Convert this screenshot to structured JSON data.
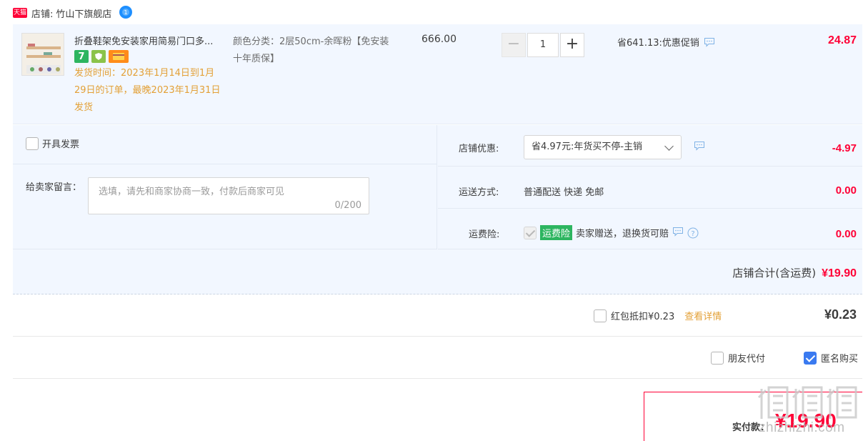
{
  "shop": {
    "platform_badge": "天猫",
    "label": "店铺:",
    "name": "竹山下旗舰店"
  },
  "item": {
    "title": "折叠鞋架免安装家用简易门口多...",
    "ship_time": "发货时间：2023年1月14日到1月29日的订单，最晚2023年1月31日发货",
    "spec": "颜色分类：2层50cm-余晖粉【免安装 十年质保】",
    "unit_price": "666.00",
    "quantity": "1",
    "qty_minus": "−",
    "qty_plus": "+",
    "promo": "省641.13:优惠促销",
    "total": "24.87",
    "tag_seven": "7"
  },
  "options": {
    "invoice_label": "开具发票",
    "message_label": "给卖家留言：",
    "message_placeholder": "选填，请先和商家协商一致，付款后商家可见",
    "message_count": "0/200",
    "shop_discount_label": "店铺优惠:",
    "shop_discount_selected": "省4.97元:年货买不停-主销",
    "shop_discount_value": "-4.97",
    "shipping_label": "运送方式:",
    "shipping_method": "普通配送 快递 免邮",
    "shipping_value": "0.00",
    "insurance_label": "运费险:",
    "insurance_badge": "运费险",
    "insurance_text": "卖家赠送，退换货可赔",
    "insurance_value": "0.00"
  },
  "store_total": {
    "label": "店铺合计(含运费)",
    "value": "¥19.90"
  },
  "red_packet": {
    "label": "红包抵扣¥0.23",
    "link": "查看详情",
    "value": "¥0.23"
  },
  "pay_mode": {
    "friend_pay": "朋友代付",
    "anonymous": "匿名购买"
  },
  "payment": {
    "label": "实付款：",
    "value": "¥19.90"
  },
  "watermark": {
    "text": "zhizhizhi.com"
  },
  "colors": {
    "price_red": "#ff0036",
    "row_bg": "#f2f7ff",
    "ship_orange": "#e3a036",
    "checkbox_blue": "#3a7af0",
    "badge_green": "#2db560"
  }
}
